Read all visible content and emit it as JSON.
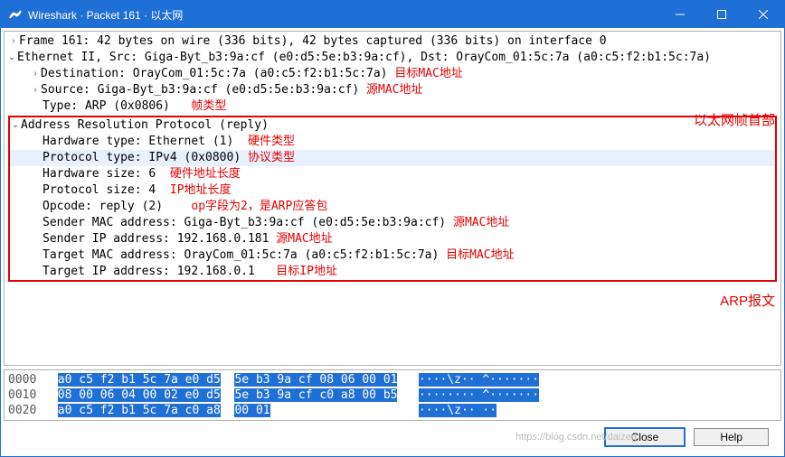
{
  "window": {
    "title": "Wireshark · Packet 161 · 以太网"
  },
  "tree": {
    "frame": "Frame 161: 42 bytes on wire (336 bits), 42 bytes captured (336 bits) on interface 0",
    "eth": {
      "header": "Ethernet II, Src: Giga-Byt_b3:9a:cf (e0:d5:5e:b3:9a:cf), Dst: OrayCom_01:5c:7a (a0:c5:f2:b1:5c:7a)",
      "dst": "Destination: OrayCom_01:5c:7a (a0:c5:f2:b1:5c:7a)",
      "dst_note": "目标MAC地址",
      "src": "Source: Giga-Byt_b3:9a:cf (e0:d5:5e:b3:9a:cf)",
      "src_note": "源MAC地址",
      "type": "Type: ARP (0x0806)",
      "type_note": "帧类型",
      "section_label": "以太网帧首部"
    },
    "arp": {
      "header": "Address Resolution Protocol (reply)",
      "hwtype": "Hardware type: Ethernet (1)",
      "hwtype_note": "硬件类型",
      "prottype": "Protocol type: IPv4 (0x0800)",
      "prottype_note": "协议类型",
      "hwsize": "Hardware size: 6",
      "hwsize_note": "硬件地址长度",
      "protsize": "Protocol size: 4",
      "protsize_note": "IP地址长度",
      "opcode": "Opcode: reply (2)",
      "opcode_note": "op字段为2，是ARP应答包",
      "smac": "Sender MAC address: Giga-Byt_b3:9a:cf (e0:d5:5e:b3:9a:cf)",
      "smac_note": "源MAC地址",
      "sip": "Sender IP address: 192.168.0.181",
      "sip_note": "源MAC地址",
      "tmac": "Target MAC address: OrayCom_01:5c:7a (a0:c5:f2:b1:5c:7a)",
      "tmac_note": "目标MAC地址",
      "tip": "Target IP address: 192.168.0.1",
      "tip_note": "目标IP地址",
      "section_label": "ARP报文"
    }
  },
  "hex": {
    "rows": [
      {
        "off": "0000",
        "a": "a0 c5 f2 b1 5c 7a e0 d5",
        "b": "5e b3 9a cf 08 06 00 01",
        "c": "····\\z·· ^·······"
      },
      {
        "off": "0010",
        "a": "08 00 06 04 00 02 e0 d5",
        "b": "5e b3 9a cf c0 a8 00 b5",
        "c": "········ ^·······"
      },
      {
        "off": "0020",
        "a": "a0 c5 f2 b1 5c 7a c0 a8",
        "b": "00 01",
        "c": "····\\z·· ··"
      }
    ]
  },
  "buttons": {
    "close": "Close",
    "help": "Help"
  },
  "watermark": "https://blog.csdn.net/daizeg"
}
